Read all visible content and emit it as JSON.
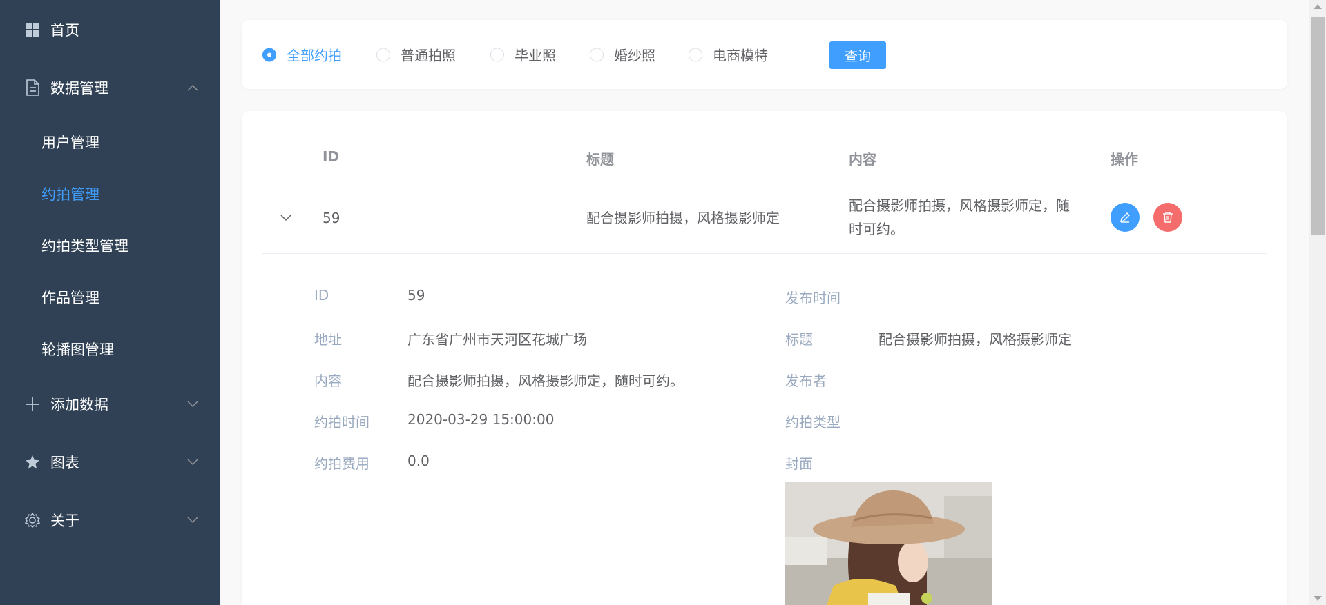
{
  "sidebar": {
    "home": "首页",
    "data_mgmt": "数据管理",
    "sub_items": [
      "用户管理",
      "约拍管理",
      "约拍类型管理",
      "作品管理",
      "轮播图管理"
    ],
    "add_data": "添加数据",
    "charts": "图表",
    "about": "关于",
    "bg_color": "#304156",
    "active_color": "#409eff"
  },
  "filter": {
    "options": [
      "全部约拍",
      "普通拍照",
      "毕业照",
      "婚纱照",
      "电商模特"
    ],
    "selected": "全部约拍",
    "query_label": "查询"
  },
  "table": {
    "headers": {
      "id": "ID",
      "title": "标题",
      "content": "内容",
      "actions": "操作"
    },
    "row": {
      "id": "59",
      "title": "配合摄影师拍摄，风格摄影师定",
      "content_line1": "配合摄影师拍摄，风格摄影师定，随",
      "content_line2": "时可约。"
    }
  },
  "detail": {
    "id_label": "ID",
    "id_value": "59",
    "address_label": "地址",
    "address_value": "广东省广州市天河区花城广场",
    "content_label": "内容",
    "content_value": "配合摄影师拍摄，风格摄影师定，随时可约。",
    "time_label": "约拍时间",
    "time_value": "2020-03-29 15:00:00",
    "fee_label": "约拍费用",
    "fee_value": "0.0",
    "publish_time_label": "发布时间",
    "title_label": "标题",
    "title_value": "配合摄影师拍摄，风格摄影师定",
    "publisher_label": "发布者",
    "type_label": "约拍类型",
    "cover_label": "封面"
  },
  "colors": {
    "primary": "#409eff",
    "danger": "#f56c6c",
    "label": "#99a9bf"
  }
}
